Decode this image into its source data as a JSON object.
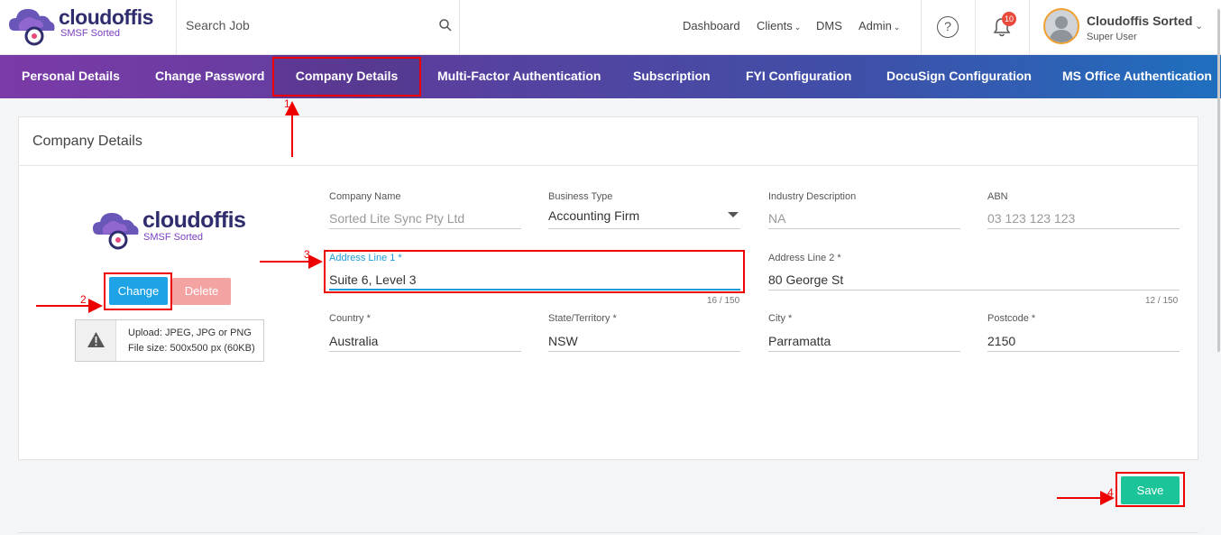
{
  "header": {
    "logo_word": "cloudoffis",
    "logo_sub": "SMSF Sorted",
    "search_placeholder": "Search Job",
    "nav": [
      "Dashboard",
      "Clients",
      "DMS",
      "Admin"
    ],
    "help": "?",
    "notification_count": "10",
    "user_name": "Cloudoffis Sorted",
    "user_role": "Super User"
  },
  "tabs": [
    "Personal Details",
    "Change Password",
    "Company Details",
    "Multi-Factor Authentication",
    "Subscription",
    "FYI Configuration",
    "DocuSign Configuration",
    "MS Office Authentication"
  ],
  "panel": {
    "title": "Company Details"
  },
  "company_logo": {
    "word": "cloudoffis",
    "sub": "SMSF Sorted"
  },
  "buttons": {
    "change": "Change",
    "delete": "Delete",
    "save": "Save"
  },
  "upload": {
    "line1": "Upload: JPEG, JPG or PNG",
    "line2": "File size: 500x500 px (60KB)"
  },
  "fields": {
    "company_name": {
      "label": "Company Name",
      "value": "Sorted Lite Sync Pty Ltd"
    },
    "business_type": {
      "label": "Business Type",
      "value": "Accounting Firm"
    },
    "industry_description": {
      "label": "Industry Description",
      "value": "NA"
    },
    "abn": {
      "label": "ABN",
      "value": "03 123 123 123"
    },
    "address_line1": {
      "label": "Address Line 1 *",
      "value": "Suite 6, Level 3",
      "counter": "16 / 150"
    },
    "address_line2": {
      "label": "Address Line 2 *",
      "value": "80 George St",
      "counter": "12 / 150"
    },
    "country": {
      "label": "Country *",
      "value": "Australia"
    },
    "state": {
      "label": "State/Territory *",
      "value": "NSW"
    },
    "city": {
      "label": "City *",
      "value": "Parramatta"
    },
    "postcode": {
      "label": "Postcode *",
      "value": "2150"
    }
  },
  "annotations": [
    "1",
    "2",
    "3",
    "4"
  ],
  "colors": {
    "accent": "#1ea4e6",
    "save": "#1cc49a",
    "delete": "#f4a3a3",
    "annotation": "#e00000"
  }
}
